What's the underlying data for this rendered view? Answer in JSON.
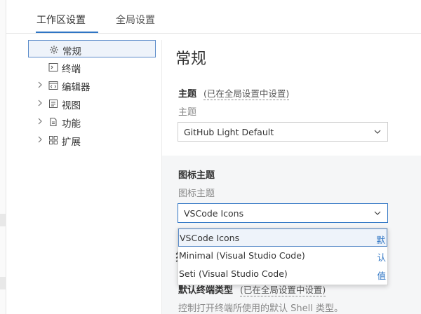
{
  "tabs": [
    {
      "label": "工作区设置",
      "active": true
    },
    {
      "label": "全局设置",
      "active": false
    }
  ],
  "tree": [
    {
      "label": "常规",
      "icon": "gear-icon",
      "expandable": false,
      "selected": true
    },
    {
      "label": "终端",
      "icon": "terminal-icon",
      "expandable": false,
      "selected": false
    },
    {
      "label": "编辑器",
      "icon": "code-window-icon",
      "expandable": true,
      "selected": false
    },
    {
      "label": "视图",
      "icon": "view-icon",
      "expandable": true,
      "selected": false
    },
    {
      "label": "功能",
      "icon": "file-icon",
      "expandable": true,
      "selected": false
    },
    {
      "label": "扩展",
      "icon": "extensions-icon",
      "expandable": true,
      "selected": false
    }
  ],
  "content": {
    "title": "常规",
    "theme": {
      "label": "主题",
      "note": "(已在全局设置中设置)",
      "desc": "主题",
      "value": "GitHub Light Default"
    },
    "icon_theme": {
      "label": "图标主题",
      "desc": "图标主题",
      "value": "VSCode Icons",
      "options": [
        {
          "label": "VSCode Icons",
          "side": "默",
          "active": true
        },
        {
          "label": "Minimal (Visual Studio Code)",
          "side": "认",
          "active": false
        },
        {
          "label": "Seti (Visual Studio Code)",
          "side": "值",
          "active": false
        }
      ]
    },
    "terminal_type": {
      "label": "默认终端类型",
      "note": "(已在全局设置中设置)",
      "desc": "控制打开终端所使用的默认 Shell 类型。"
    },
    "hidden_heading_glyph": "终"
  },
  "colors": {
    "accent": "#2f75c4",
    "selected_bg": "#eef3fa"
  }
}
